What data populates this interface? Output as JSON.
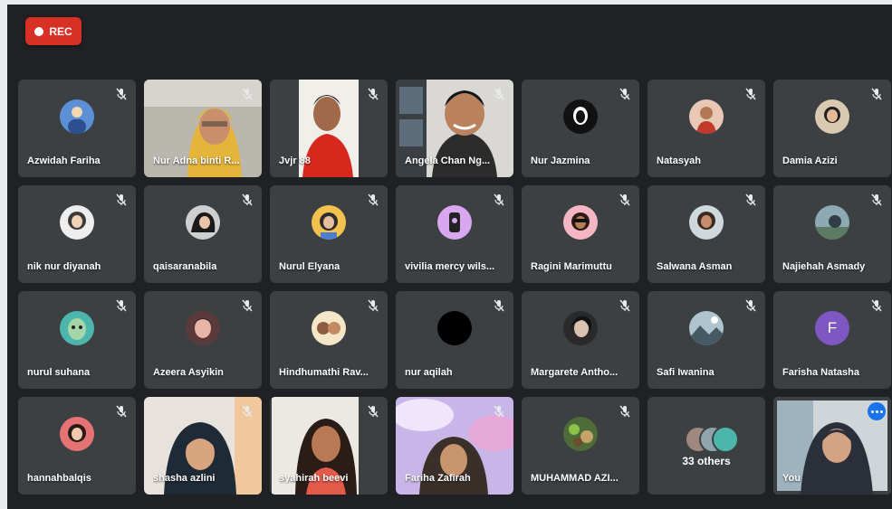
{
  "rec": {
    "label": "REC"
  },
  "colors": {
    "rec_red": "#d93025",
    "tile_bg": "#3c4043",
    "self_outline": "#8ab4f8",
    "avatar_F": "#7e57c2"
  },
  "participants": [
    {
      "name": "Azwidah Fariha",
      "kind": "avatar"
    },
    {
      "name": "Nur Adna binti R...",
      "kind": "video"
    },
    {
      "name": "Jvjr 88",
      "kind": "video"
    },
    {
      "name": "Angela Chan Ng...",
      "kind": "video"
    },
    {
      "name": "Nur Jazmina",
      "kind": "avatar"
    },
    {
      "name": "Natasyah",
      "kind": "avatar"
    },
    {
      "name": "Damia Azizi",
      "kind": "avatar"
    },
    {
      "name": "nik nur diyanah",
      "kind": "avatar"
    },
    {
      "name": "qaisaranabila",
      "kind": "avatar"
    },
    {
      "name": "Nurul Elyana",
      "kind": "avatar"
    },
    {
      "name": "vivilia mercy wils...",
      "kind": "avatar"
    },
    {
      "name": "Ragini Marimuttu",
      "kind": "avatar"
    },
    {
      "name": "Salwana Asman",
      "kind": "avatar"
    },
    {
      "name": "Najiehah Asmady",
      "kind": "avatar"
    },
    {
      "name": "nurul suhana",
      "kind": "avatar"
    },
    {
      "name": "Azeera Asyikin",
      "kind": "avatar"
    },
    {
      "name": "Hindhumathi Rav...",
      "kind": "avatar"
    },
    {
      "name": "nur aqilah",
      "kind": "avatar"
    },
    {
      "name": "Margarete Antho...",
      "kind": "avatar"
    },
    {
      "name": "Safi Iwanina",
      "kind": "avatar"
    },
    {
      "name": "Farisha Natasha",
      "kind": "letter",
      "letter": "F"
    },
    {
      "name": "hannahbalqis",
      "kind": "avatar"
    },
    {
      "name": "shasha azlini",
      "kind": "video"
    },
    {
      "name": "syahirah beevi",
      "kind": "video"
    },
    {
      "name": "Fariha Zafirah",
      "kind": "video"
    },
    {
      "name": "MUHAMMAD AZI...",
      "kind": "avatar"
    },
    {
      "name": "",
      "kind": "others",
      "label": "33 others"
    },
    {
      "name": "You",
      "kind": "self"
    }
  ]
}
